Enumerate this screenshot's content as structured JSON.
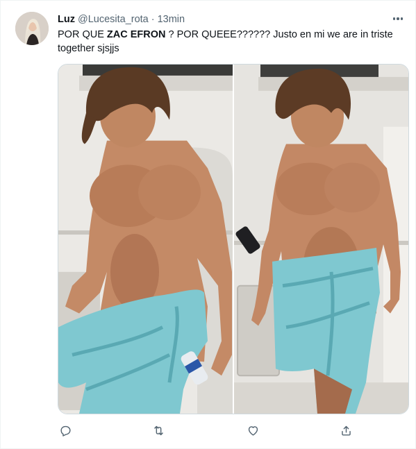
{
  "tweet": {
    "display_name": "Luz",
    "handle": "@Lucesita_rota",
    "separator": "·",
    "time": "13min",
    "text_part1": "POR QUE ",
    "text_bold": "ZAC EFRON",
    "text_part2": " ? POR QUEEE?????? Justo en mi we are in triste together sjsjjs"
  },
  "media": {
    "images": [
      {
        "name": "photo-left-icon",
        "description_icon": "photo"
      },
      {
        "name": "photo-right-icon",
        "description_icon": "photo"
      }
    ]
  },
  "actions": [
    {
      "icon": "reply-icon"
    },
    {
      "icon": "retweet-icon"
    },
    {
      "icon": "like-icon"
    },
    {
      "icon": "share-icon"
    }
  ],
  "colors": {
    "text_primary": "#0f1419",
    "text_secondary": "#536471",
    "border": "#cfd9de",
    "towel": "#7fc8d0"
  }
}
